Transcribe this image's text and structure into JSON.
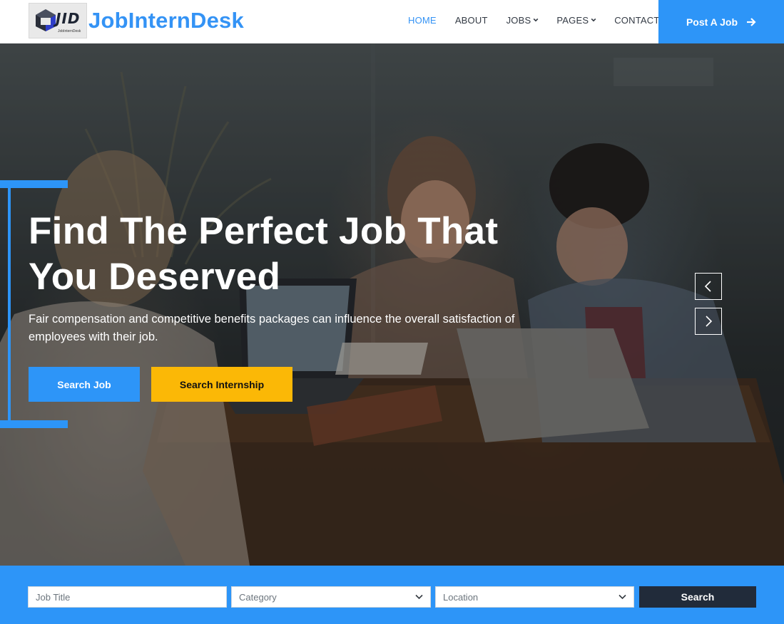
{
  "brand": {
    "logo_letters": "JID",
    "logo_caption": "JobInternDesk",
    "name": "JobInternDesk"
  },
  "nav": {
    "items": [
      {
        "label": "HOME",
        "active": true,
        "dropdown": false
      },
      {
        "label": "ABOUT",
        "active": false,
        "dropdown": false
      },
      {
        "label": "JOBS",
        "active": false,
        "dropdown": true
      },
      {
        "label": "PAGES",
        "active": false,
        "dropdown": true
      },
      {
        "label": "CONTACT",
        "active": false,
        "dropdown": false
      }
    ],
    "cta_label": "Post A Job"
  },
  "hero": {
    "title": "Find The Perfect Job That You Deserved",
    "text": "Fair compensation and competitive benefits packages can influence the overall satisfaction of employees with their job.",
    "primary_button": "Search Job",
    "secondary_button": "Search Internship"
  },
  "search": {
    "job_title_placeholder": "Job Title",
    "category_label": "Category",
    "location_label": "Location",
    "button_label": "Search"
  },
  "colors": {
    "primary": "#2d95f8",
    "accent": "#fbb806",
    "dark": "#212b3a"
  },
  "icons": {
    "slide_prev": "chevron-left-icon",
    "slide_next": "chevron-right-icon",
    "cta_arrow": "arrow-right-icon",
    "dropdown": "chevron-down-icon"
  }
}
